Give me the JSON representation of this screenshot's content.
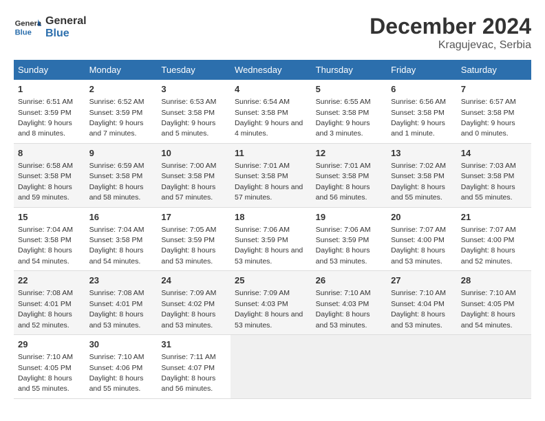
{
  "header": {
    "logo_line1": "General",
    "logo_line2": "Blue",
    "main_title": "December 2024",
    "subtitle": "Kragujevac, Serbia"
  },
  "columns": [
    "Sunday",
    "Monday",
    "Tuesday",
    "Wednesday",
    "Thursday",
    "Friday",
    "Saturday"
  ],
  "weeks": [
    [
      {
        "day": "1",
        "info": "Sunrise: 6:51 AM\nSunset: 3:59 PM\nDaylight: 9 hours and 8 minutes."
      },
      {
        "day": "2",
        "info": "Sunrise: 6:52 AM\nSunset: 3:59 PM\nDaylight: 9 hours and 7 minutes."
      },
      {
        "day": "3",
        "info": "Sunrise: 6:53 AM\nSunset: 3:58 PM\nDaylight: 9 hours and 5 minutes."
      },
      {
        "day": "4",
        "info": "Sunrise: 6:54 AM\nSunset: 3:58 PM\nDaylight: 9 hours and 4 minutes."
      },
      {
        "day": "5",
        "info": "Sunrise: 6:55 AM\nSunset: 3:58 PM\nDaylight: 9 hours and 3 minutes."
      },
      {
        "day": "6",
        "info": "Sunrise: 6:56 AM\nSunset: 3:58 PM\nDaylight: 9 hours and 1 minute."
      },
      {
        "day": "7",
        "info": "Sunrise: 6:57 AM\nSunset: 3:58 PM\nDaylight: 9 hours and 0 minutes."
      }
    ],
    [
      {
        "day": "8",
        "info": "Sunrise: 6:58 AM\nSunset: 3:58 PM\nDaylight: 8 hours and 59 minutes."
      },
      {
        "day": "9",
        "info": "Sunrise: 6:59 AM\nSunset: 3:58 PM\nDaylight: 8 hours and 58 minutes."
      },
      {
        "day": "10",
        "info": "Sunrise: 7:00 AM\nSunset: 3:58 PM\nDaylight: 8 hours and 57 minutes."
      },
      {
        "day": "11",
        "info": "Sunrise: 7:01 AM\nSunset: 3:58 PM\nDaylight: 8 hours and 57 minutes."
      },
      {
        "day": "12",
        "info": "Sunrise: 7:01 AM\nSunset: 3:58 PM\nDaylight: 8 hours and 56 minutes."
      },
      {
        "day": "13",
        "info": "Sunrise: 7:02 AM\nSunset: 3:58 PM\nDaylight: 8 hours and 55 minutes."
      },
      {
        "day": "14",
        "info": "Sunrise: 7:03 AM\nSunset: 3:58 PM\nDaylight: 8 hours and 55 minutes."
      }
    ],
    [
      {
        "day": "15",
        "info": "Sunrise: 7:04 AM\nSunset: 3:58 PM\nDaylight: 8 hours and 54 minutes."
      },
      {
        "day": "16",
        "info": "Sunrise: 7:04 AM\nSunset: 3:58 PM\nDaylight: 8 hours and 54 minutes."
      },
      {
        "day": "17",
        "info": "Sunrise: 7:05 AM\nSunset: 3:59 PM\nDaylight: 8 hours and 53 minutes."
      },
      {
        "day": "18",
        "info": "Sunrise: 7:06 AM\nSunset: 3:59 PM\nDaylight: 8 hours and 53 minutes."
      },
      {
        "day": "19",
        "info": "Sunrise: 7:06 AM\nSunset: 3:59 PM\nDaylight: 8 hours and 53 minutes."
      },
      {
        "day": "20",
        "info": "Sunrise: 7:07 AM\nSunset: 4:00 PM\nDaylight: 8 hours and 53 minutes."
      },
      {
        "day": "21",
        "info": "Sunrise: 7:07 AM\nSunset: 4:00 PM\nDaylight: 8 hours and 52 minutes."
      }
    ],
    [
      {
        "day": "22",
        "info": "Sunrise: 7:08 AM\nSunset: 4:01 PM\nDaylight: 8 hours and 52 minutes."
      },
      {
        "day": "23",
        "info": "Sunrise: 7:08 AM\nSunset: 4:01 PM\nDaylight: 8 hours and 53 minutes."
      },
      {
        "day": "24",
        "info": "Sunrise: 7:09 AM\nSunset: 4:02 PM\nDaylight: 8 hours and 53 minutes."
      },
      {
        "day": "25",
        "info": "Sunrise: 7:09 AM\nSunset: 4:03 PM\nDaylight: 8 hours and 53 minutes."
      },
      {
        "day": "26",
        "info": "Sunrise: 7:10 AM\nSunset: 4:03 PM\nDaylight: 8 hours and 53 minutes."
      },
      {
        "day": "27",
        "info": "Sunrise: 7:10 AM\nSunset: 4:04 PM\nDaylight: 8 hours and 53 minutes."
      },
      {
        "day": "28",
        "info": "Sunrise: 7:10 AM\nSunset: 4:05 PM\nDaylight: 8 hours and 54 minutes."
      }
    ],
    [
      {
        "day": "29",
        "info": "Sunrise: 7:10 AM\nSunset: 4:05 PM\nDaylight: 8 hours and 55 minutes."
      },
      {
        "day": "30",
        "info": "Sunrise: 7:10 AM\nSunset: 4:06 PM\nDaylight: 8 hours and 55 minutes."
      },
      {
        "day": "31",
        "info": "Sunrise: 7:11 AM\nSunset: 4:07 PM\nDaylight: 8 hours and 56 minutes."
      },
      null,
      null,
      null,
      null
    ]
  ]
}
